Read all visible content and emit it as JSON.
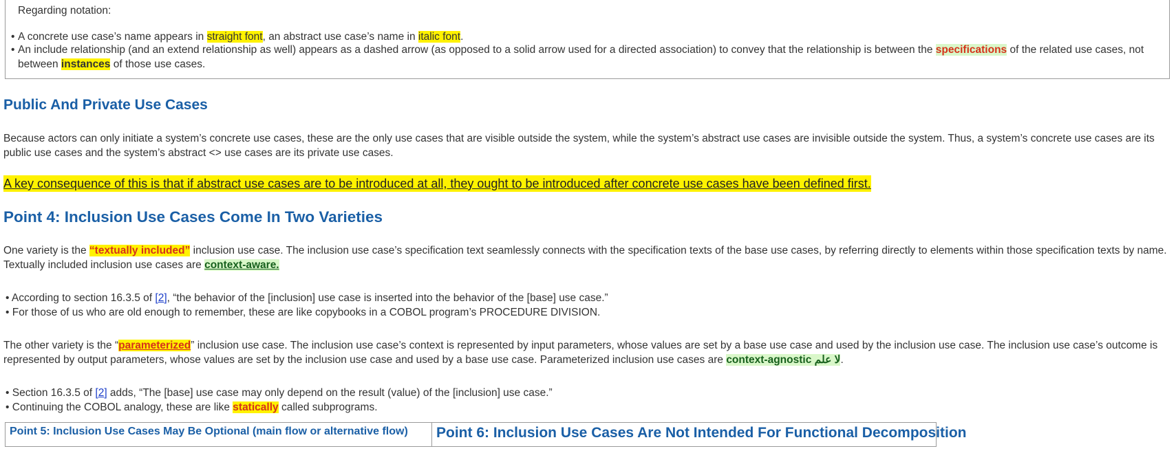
{
  "notation": {
    "heading": "Regarding notation:",
    "bullet1": {
      "pre": "A concrete use case’s name appears in ",
      "hl1": "straight font",
      "mid": ", an abstract use case’s name in ",
      "hl2": "italic font",
      "post": "."
    },
    "bullet2": {
      "pre": "An include relationship (and an extend relationship as well) appears as a dashed arrow (as opposed to a solid arrow used for a directed association) to convey that the relationship is between the ",
      "hl1": "specifications",
      "mid": " of the related use cases, not",
      "line2_pre": "between ",
      "hl2": "instances",
      "post": " of those use cases."
    }
  },
  "section_public": {
    "title": "Public And Private Use Cases",
    "para": "Because actors can only initiate a system’s concrete use cases, these are the only use cases that are visible outside the system, while the system’s abstract use cases are invisible outside the system.  Thus, a system’s concrete use cases are its public use cases and the system’s abstract <> use cases are its private use cases.",
    "key": "A key consequence of this is that if abstract use cases are to be introduced at all, they ought to be introduced after concrete use cases have been defined first. "
  },
  "section_point4": {
    "title": "Point 4: Inclusion Use Cases Come In Two Varieties",
    "p1": {
      "pre": "One variety is the ",
      "hl": "“textually included”",
      "mid": " inclusion use case.  The inclusion use case’s specification text seamlessly connects with the specification texts of the base use cases, by referring directly to elements within those specification texts by name.  Textually included inclusion use cases are ",
      "tag": "context-aware."
    },
    "bullets1": {
      "b1_pre": "According to section 16.3.5 of ",
      "b1_link": "[2]",
      "b1_post": ", “the behavior of the [inclusion] use case is inserted into the behavior of the [base] use case.”",
      "b2": "For those of us who are old enough to remember, these are like copybooks in a COBOL program’s PROCEDURE DIVISION."
    },
    "p2": {
      "pre": "The other variety is the “",
      "hl": "parameterized",
      "mid": "” inclusion use case.  The inclusion use case’s context is represented by input parameters, whose values are set by a base use case and used by the inclusion use case.  The inclusion use case’s outcome is represented by output parameters, whose values are set by the inclusion use case and used by a base use case.  Parameterized inclusion use cases are ",
      "tag": "context-agnostic لا علم",
      "post": "."
    },
    "bullets2": {
      "b1_pre": "Section 16.3.5 of ",
      "b1_link": "[2]",
      "b1_post": " adds, “The [base] use case may only depend on the result (value) of the [inclusion] use case.”",
      "b2_pre": "Continuing the COBOL analogy, these are like ",
      "b2_hl": "statically",
      "b2_post": " called subprograms."
    }
  },
  "bottom_table": {
    "cell1": "Point 5: Inclusion Use Cases May Be Optional (main flow or alternative flow)",
    "cell2": "Point 6: Inclusion Use Cases Are Not Intended For Functional Decomposition"
  },
  "bullet_char": "•",
  "colors": {
    "heading": "#1a5fa6",
    "highlight": "#fff200",
    "green_highlight": "#d9f7c9",
    "accent_red": "#d6321b"
  }
}
